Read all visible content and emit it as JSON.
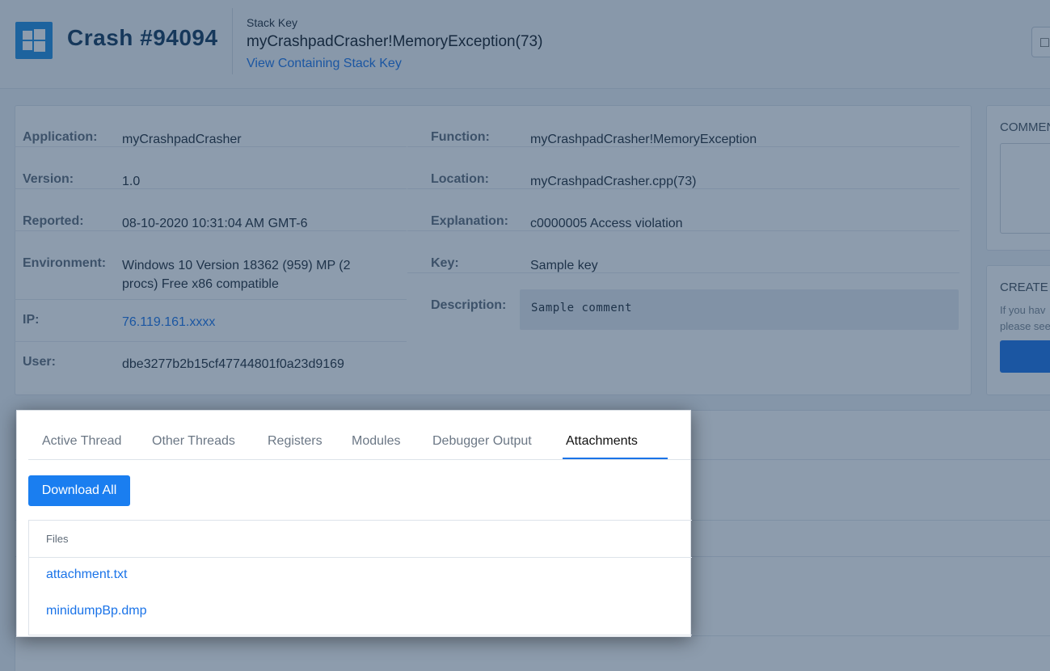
{
  "header": {
    "crash_title": "Crash #94094",
    "stack_key_caption": "Stack Key",
    "stack_key_value": "myCrashpadCrasher!MemoryException(73)",
    "containing_stack_link": "View Containing Stack Key"
  },
  "details_left": [
    {
      "label": "Application:",
      "value": "myCrashpadCrasher"
    },
    {
      "label": "Version:",
      "value": "1.0"
    },
    {
      "label": "Reported:",
      "value": "08-10-2020 10:31:04 AM GMT-6"
    },
    {
      "label": "Environment:",
      "value": "Windows 10 Version 18362 (959) MP (2 procs) Free x86 compatible"
    },
    {
      "label": "IP:",
      "value": "76.119.161.xxxx"
    },
    {
      "label": "User:",
      "value": "dbe3277b2b15cf47744801f0a23d9169"
    }
  ],
  "details_right": [
    {
      "label": "Function:",
      "value": "myCrashpadCrasher!MemoryException"
    },
    {
      "label": "Location:",
      "value": "myCrashpadCrasher.cpp(73)"
    },
    {
      "label": "Explanation:",
      "value": "c0000005 Access violation"
    },
    {
      "label": "Key:",
      "value": "Sample key"
    },
    {
      "label": "Description:",
      "value": "Sample comment"
    }
  ],
  "side": {
    "comments_title": "COMMEN",
    "create_title": "CREATE I",
    "create_hint_1": "If you hav",
    "create_hint_2": "please see"
  },
  "tabs": [
    {
      "label": "Active Thread"
    },
    {
      "label": "Other Threads"
    },
    {
      "label": "Registers"
    },
    {
      "label": "Modules"
    },
    {
      "label": "Debugger Output"
    },
    {
      "label": "Attachments",
      "active": true
    }
  ],
  "attachments": {
    "download_all_label": "Download All",
    "files_header": "Files",
    "files": [
      "attachment.txt",
      "minidumpBp.dmp"
    ]
  },
  "colors": {
    "accent": "#1a73e8",
    "logo_bg": "#1f8de0",
    "title": "#10365a",
    "overlay": "rgba(27,58,92,0.50)"
  }
}
